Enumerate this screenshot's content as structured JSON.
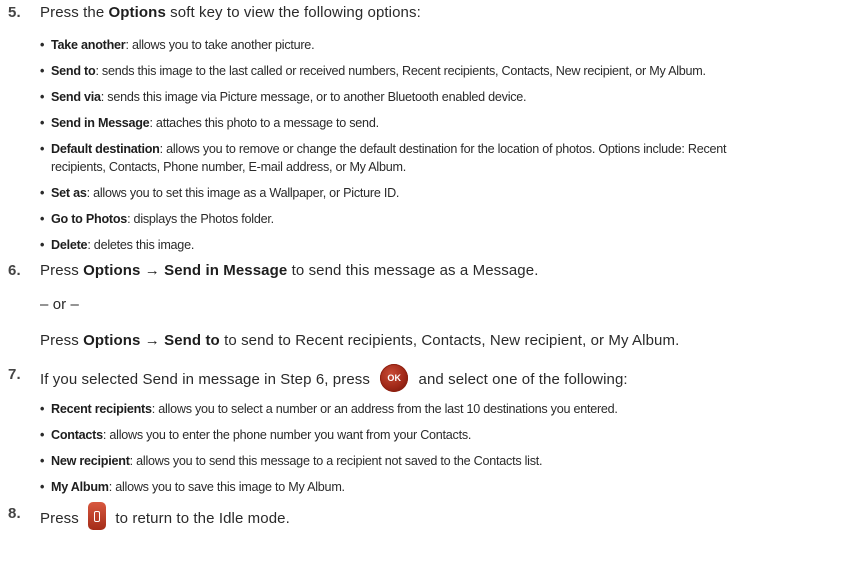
{
  "steps": {
    "s5": {
      "num": "5.",
      "pre": "Press the ",
      "bold": "Options",
      "post": " soft key to view the following options:"
    },
    "s6": {
      "num": "6.",
      "pre": "Press ",
      "bold": "Options → Send in Message",
      "post": " to send this message as a Message."
    },
    "or": "– or –",
    "s6b": {
      "pre": "Press ",
      "bold": "Options → Send to",
      "post": " to send to Recent recipients, Contacts, New recipient, or My Album."
    },
    "s7": {
      "num": "7.",
      "pre": "If you selected Send in message in Step 6, press ",
      "key": "OK",
      "post": " and select one of the following:"
    },
    "s8": {
      "num": "8.",
      "pre": "Press ",
      "post": " to return to the Idle mode."
    }
  },
  "options": [
    {
      "term": "Take another",
      "desc": ": allows you to take another picture."
    },
    {
      "term": "Send to",
      "desc": ": sends this image to the last called or received numbers, Recent recipients, Contacts, New recipient, or My Album."
    },
    {
      "term": "Send  via",
      "desc": ": sends this image via Picture message, or to another Bluetooth enabled device."
    },
    {
      "term": "Send in Message",
      "desc": ": attaches this photo to a message to send."
    },
    {
      "term": "Default destination",
      "desc": ": allows you to remove or change the default destination for the location of photos. Options include: Recent",
      "cont": "recipients, Contacts, Phone number, E-mail address, or My Album."
    },
    {
      "term": "Set as",
      "desc": ": allows you to set this image as a Wallpaper, or Picture ID."
    },
    {
      "term": "Go to Photos",
      "desc": ": displays the Photos folder."
    },
    {
      "term": "Delete",
      "desc": ": deletes this image."
    }
  ],
  "send_options": [
    {
      "term": "Recent recipients",
      "desc": ": allows you to select a number or an address from the last 10 destinations you entered."
    },
    {
      "term": "Contacts",
      "desc": ": allows you to enter the phone number you want from your Contacts."
    },
    {
      "term": "New recipient",
      "desc": ": allows you to send this message to a recipient not saved to the Contacts list."
    },
    {
      "term": "My Album",
      "desc": ": allows you to save this image to My Album."
    }
  ]
}
